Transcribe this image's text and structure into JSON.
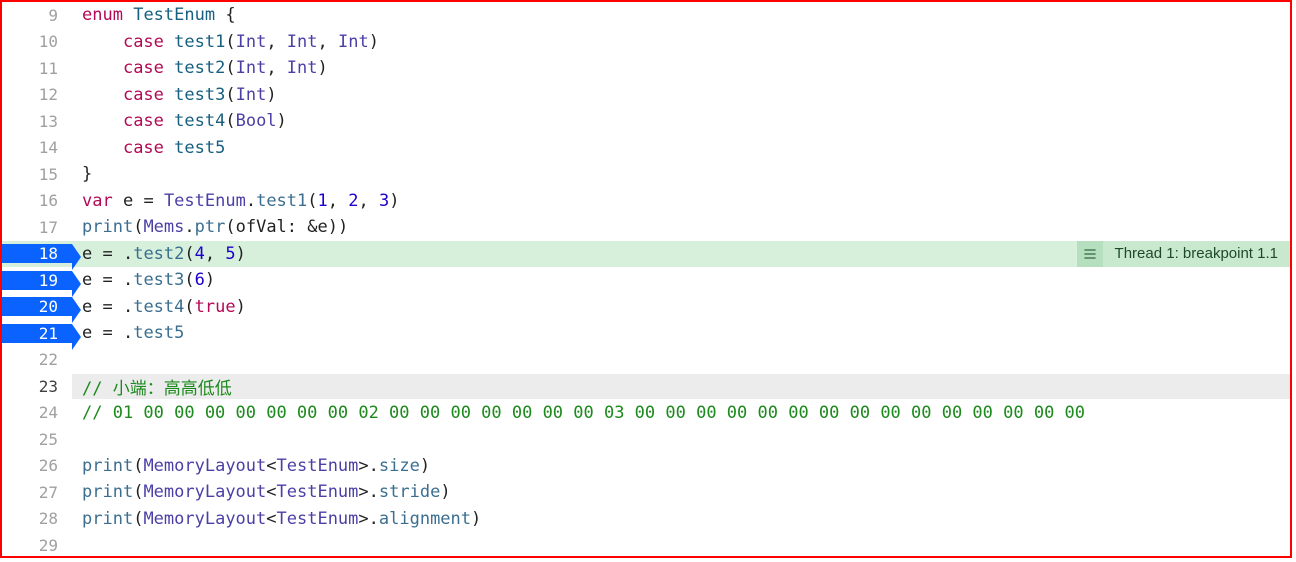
{
  "thread_badge": "Thread 1: breakpoint 1.1",
  "lines": [
    {
      "n": 9,
      "bp": false,
      "exec": false,
      "cur": false,
      "tokens": [
        {
          "c": "kw",
          "t": "enum"
        },
        {
          "c": "op",
          "t": " "
        },
        {
          "c": "typedef",
          "t": "TestEnum"
        },
        {
          "c": "op",
          "t": " {"
        }
      ]
    },
    {
      "n": 10,
      "bp": false,
      "exec": false,
      "cur": false,
      "tokens": [
        {
          "c": "op",
          "t": "    "
        },
        {
          "c": "kw",
          "t": "case"
        },
        {
          "c": "op",
          "t": " "
        },
        {
          "c": "typedef",
          "t": "test1"
        },
        {
          "c": "op",
          "t": "("
        },
        {
          "c": "type",
          "t": "Int"
        },
        {
          "c": "op",
          "t": ", "
        },
        {
          "c": "type",
          "t": "Int"
        },
        {
          "c": "op",
          "t": ", "
        },
        {
          "c": "type",
          "t": "Int"
        },
        {
          "c": "op",
          "t": ")"
        }
      ]
    },
    {
      "n": 11,
      "bp": false,
      "exec": false,
      "cur": false,
      "tokens": [
        {
          "c": "op",
          "t": "    "
        },
        {
          "c": "kw",
          "t": "case"
        },
        {
          "c": "op",
          "t": " "
        },
        {
          "c": "typedef",
          "t": "test2"
        },
        {
          "c": "op",
          "t": "("
        },
        {
          "c": "type",
          "t": "Int"
        },
        {
          "c": "op",
          "t": ", "
        },
        {
          "c": "type",
          "t": "Int"
        },
        {
          "c": "op",
          "t": ")"
        }
      ]
    },
    {
      "n": 12,
      "bp": false,
      "exec": false,
      "cur": false,
      "tokens": [
        {
          "c": "op",
          "t": "    "
        },
        {
          "c": "kw",
          "t": "case"
        },
        {
          "c": "op",
          "t": " "
        },
        {
          "c": "typedef",
          "t": "test3"
        },
        {
          "c": "op",
          "t": "("
        },
        {
          "c": "type",
          "t": "Int"
        },
        {
          "c": "op",
          "t": ")"
        }
      ]
    },
    {
      "n": 13,
      "bp": false,
      "exec": false,
      "cur": false,
      "tokens": [
        {
          "c": "op",
          "t": "    "
        },
        {
          "c": "kw",
          "t": "case"
        },
        {
          "c": "op",
          "t": " "
        },
        {
          "c": "typedef",
          "t": "test4"
        },
        {
          "c": "op",
          "t": "("
        },
        {
          "c": "type",
          "t": "Bool"
        },
        {
          "c": "op",
          "t": ")"
        }
      ]
    },
    {
      "n": 14,
      "bp": false,
      "exec": false,
      "cur": false,
      "tokens": [
        {
          "c": "op",
          "t": "    "
        },
        {
          "c": "kw",
          "t": "case"
        },
        {
          "c": "op",
          "t": " "
        },
        {
          "c": "typedef",
          "t": "test5"
        }
      ]
    },
    {
      "n": 15,
      "bp": false,
      "exec": false,
      "cur": false,
      "tokens": [
        {
          "c": "op",
          "t": "}"
        }
      ]
    },
    {
      "n": 16,
      "bp": false,
      "exec": false,
      "cur": false,
      "tokens": [
        {
          "c": "kw",
          "t": "var"
        },
        {
          "c": "op",
          "t": " "
        },
        {
          "c": "id",
          "t": "e"
        },
        {
          "c": "op",
          "t": " = "
        },
        {
          "c": "type",
          "t": "TestEnum"
        },
        {
          "c": "op",
          "t": "."
        },
        {
          "c": "func",
          "t": "test1"
        },
        {
          "c": "op",
          "t": "("
        },
        {
          "c": "num",
          "t": "1"
        },
        {
          "c": "op",
          "t": ", "
        },
        {
          "c": "num",
          "t": "2"
        },
        {
          "c": "op",
          "t": ", "
        },
        {
          "c": "num",
          "t": "3"
        },
        {
          "c": "op",
          "t": ")"
        }
      ]
    },
    {
      "n": 17,
      "bp": false,
      "exec": false,
      "cur": false,
      "tokens": [
        {
          "c": "func",
          "t": "print"
        },
        {
          "c": "op",
          "t": "("
        },
        {
          "c": "type",
          "t": "Mems"
        },
        {
          "c": "op",
          "t": "."
        },
        {
          "c": "func",
          "t": "ptr"
        },
        {
          "c": "op",
          "t": "("
        },
        {
          "c": "id",
          "t": "ofVal"
        },
        {
          "c": "op",
          "t": ": &"
        },
        {
          "c": "id",
          "t": "e"
        },
        {
          "c": "op",
          "t": "))"
        }
      ]
    },
    {
      "n": 18,
      "bp": true,
      "exec": true,
      "cur": false,
      "tokens": [
        {
          "c": "id",
          "t": "e"
        },
        {
          "c": "op",
          "t": " = ."
        },
        {
          "c": "func",
          "t": "test2"
        },
        {
          "c": "op",
          "t": "("
        },
        {
          "c": "num",
          "t": "4"
        },
        {
          "c": "op",
          "t": ", "
        },
        {
          "c": "num",
          "t": "5"
        },
        {
          "c": "op",
          "t": ")"
        }
      ]
    },
    {
      "n": 19,
      "bp": true,
      "exec": false,
      "cur": false,
      "tokens": [
        {
          "c": "id",
          "t": "e"
        },
        {
          "c": "op",
          "t": " = ."
        },
        {
          "c": "func",
          "t": "test3"
        },
        {
          "c": "op",
          "t": "("
        },
        {
          "c": "num",
          "t": "6"
        },
        {
          "c": "op",
          "t": ")"
        }
      ]
    },
    {
      "n": 20,
      "bp": true,
      "exec": false,
      "cur": false,
      "tokens": [
        {
          "c": "id",
          "t": "e"
        },
        {
          "c": "op",
          "t": " = ."
        },
        {
          "c": "func",
          "t": "test4"
        },
        {
          "c": "op",
          "t": "("
        },
        {
          "c": "kw",
          "t": "true"
        },
        {
          "c": "op",
          "t": ")"
        }
      ]
    },
    {
      "n": 21,
      "bp": true,
      "exec": false,
      "cur": false,
      "tokens": [
        {
          "c": "id",
          "t": "e"
        },
        {
          "c": "op",
          "t": " = ."
        },
        {
          "c": "func",
          "t": "test5"
        }
      ]
    },
    {
      "n": 22,
      "bp": false,
      "exec": false,
      "cur": false,
      "tokens": []
    },
    {
      "n": 23,
      "bp": false,
      "exec": false,
      "cur": true,
      "tokens": [
        {
          "c": "cmt",
          "t": "// 小端：高高低低"
        }
      ]
    },
    {
      "n": 24,
      "bp": false,
      "exec": false,
      "cur": false,
      "tokens": [
        {
          "c": "cmt",
          "t": "// 01 00 00 00 00 00 00 00 02 00 00 00 00 00 00 00 03 00 00 00 00 00 00 00 00 00 00 00 00 00 00 00"
        }
      ]
    },
    {
      "n": 25,
      "bp": false,
      "exec": false,
      "cur": false,
      "tokens": []
    },
    {
      "n": 26,
      "bp": false,
      "exec": false,
      "cur": false,
      "tokens": [
        {
          "c": "func",
          "t": "print"
        },
        {
          "c": "op",
          "t": "("
        },
        {
          "c": "type",
          "t": "MemoryLayout"
        },
        {
          "c": "op",
          "t": "<"
        },
        {
          "c": "type",
          "t": "TestEnum"
        },
        {
          "c": "op",
          "t": ">."
        },
        {
          "c": "func",
          "t": "size"
        },
        {
          "c": "op",
          "t": ")"
        }
      ]
    },
    {
      "n": 27,
      "bp": false,
      "exec": false,
      "cur": false,
      "tokens": [
        {
          "c": "func",
          "t": "print"
        },
        {
          "c": "op",
          "t": "("
        },
        {
          "c": "type",
          "t": "MemoryLayout"
        },
        {
          "c": "op",
          "t": "<"
        },
        {
          "c": "type",
          "t": "TestEnum"
        },
        {
          "c": "op",
          "t": ">."
        },
        {
          "c": "func",
          "t": "stride"
        },
        {
          "c": "op",
          "t": ")"
        }
      ]
    },
    {
      "n": 28,
      "bp": false,
      "exec": false,
      "cur": false,
      "tokens": [
        {
          "c": "func",
          "t": "print"
        },
        {
          "c": "op",
          "t": "("
        },
        {
          "c": "type",
          "t": "MemoryLayout"
        },
        {
          "c": "op",
          "t": "<"
        },
        {
          "c": "type",
          "t": "TestEnum"
        },
        {
          "c": "op",
          "t": ">."
        },
        {
          "c": "func",
          "t": "alignment"
        },
        {
          "c": "op",
          "t": ")"
        }
      ]
    },
    {
      "n": 29,
      "bp": false,
      "exec": false,
      "cur": false,
      "tokens": []
    }
  ]
}
